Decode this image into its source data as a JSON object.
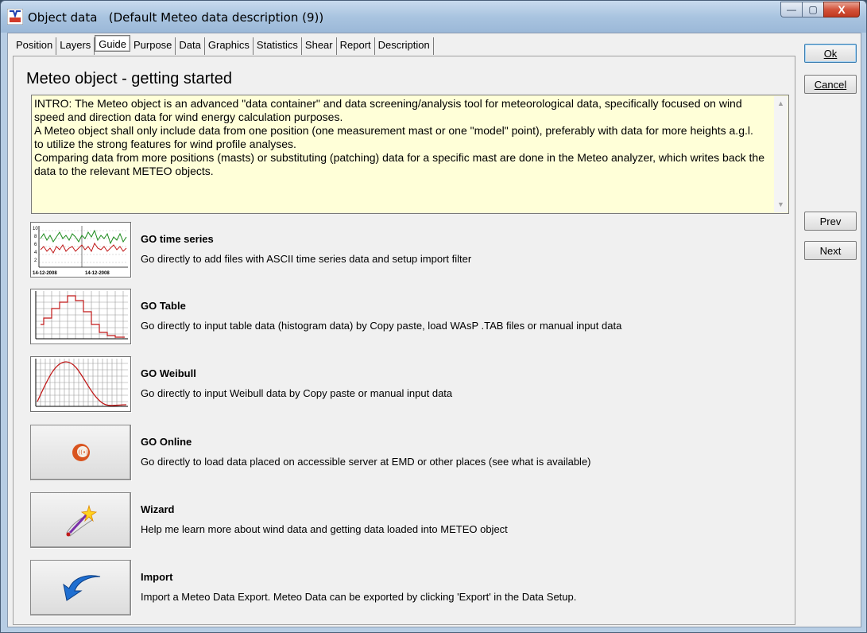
{
  "window": {
    "title": "Object data   (Default Meteo data description (9))",
    "app_icon": "windpro-icon",
    "controls": {
      "minimize": "—",
      "maximize": "▢",
      "close": "X"
    }
  },
  "tabs": [
    {
      "label": "Position",
      "active": false
    },
    {
      "label": "Layers",
      "active": false
    },
    {
      "label": "Guide",
      "active": true
    },
    {
      "label": "Purpose",
      "active": false
    },
    {
      "label": "Data",
      "active": false
    },
    {
      "label": "Graphics",
      "active": false
    },
    {
      "label": "Statistics",
      "active": false
    },
    {
      "label": "Shear",
      "active": false
    },
    {
      "label": "Report",
      "active": false
    },
    {
      "label": "Description",
      "active": false
    }
  ],
  "guide": {
    "heading": "Meteo object - getting started",
    "intro": "INTRO: The Meteo object is an advanced \"data container\" and data screening/analysis tool for meteorological data, specifically focused on wind speed and direction data for wind energy calculation purposes.\nA Meteo object shall only include data from one position (one measurement mast or one \"model\" point), preferably with data for more heights a.g.l. to utilize the strong features for wind profile analyses.\nComparing data from more positions (masts) or substituting (patching) data for a specific mast are done in the Meteo analyzer, which writes back the data to the relevant METEO objects.",
    "items": [
      {
        "title": "GO time series",
        "desc": "Go directly to add files with ASCII time series data and setup import filter",
        "thumb_icon": "time-series-chart-icon",
        "thumb_labels": [
          "14-12-2008",
          "14-12-2008"
        ],
        "thumb_y_ticks": [
          "10",
          "8",
          "6",
          "4",
          "2"
        ]
      },
      {
        "title": "GO Table",
        "desc": "Go directly to input table data (histogram data) by Copy paste, load WAsP .TAB files or manual input data",
        "thumb_icon": "histogram-chart-icon"
      },
      {
        "title": "GO Weibull",
        "desc": "Go directly to input Weibull data by Copy paste or manual input data",
        "thumb_icon": "weibull-curve-icon"
      },
      {
        "title": "GO Online",
        "desc": "Go directly to load data placed on accessible server at EMD or other places (see what is available)",
        "thumb_icon": "online-globe-icon"
      },
      {
        "title": "Wizard",
        "desc": "Help me learn more about wind data and getting data loaded into METEO object",
        "thumb_icon": "magic-wand-icon"
      },
      {
        "title": "Import",
        "desc": "Import a Meteo Data Export. Meteo Data can be exported by clicking 'Export' in the Data Setup.",
        "thumb_icon": "import-arrow-icon"
      }
    ]
  },
  "buttons": {
    "ok": "Ok",
    "cancel": "Cancel",
    "prev": "Prev",
    "next": "Next"
  },
  "colors": {
    "intro_bg": "#ffffd8",
    "series_green": "#1a8a1a",
    "series_red": "#c01818",
    "online_orange": "#d9531e",
    "import_blue": "#1f6fd1"
  }
}
